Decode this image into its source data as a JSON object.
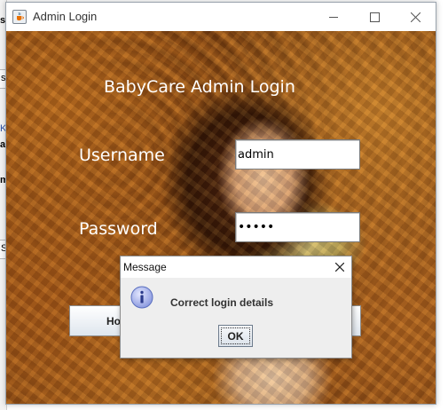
{
  "window": {
    "title": "Admin Login",
    "heading": "BabyCare Admin Login"
  },
  "form": {
    "username_label": "Username",
    "username_value": "admin",
    "password_label": "Password",
    "password_masked": "•••••"
  },
  "buttons": {
    "home_label_partial": "Ho"
  },
  "dialog": {
    "title": "Message",
    "message": "Correct login details",
    "ok_label": "OK"
  },
  "background_fragments": [
    "s",
    "s",
    "a",
    "m",
    "S",
    "K"
  ],
  "icons": {
    "app": "java-cup-icon",
    "minimize": "minimize-icon",
    "maximize": "maximize-icon",
    "close": "close-icon",
    "info": "info-icon",
    "dialog_close": "close-icon"
  },
  "colors": {
    "info_icon": "#5a6fbf",
    "dialog_body": "#eeeeee"
  }
}
